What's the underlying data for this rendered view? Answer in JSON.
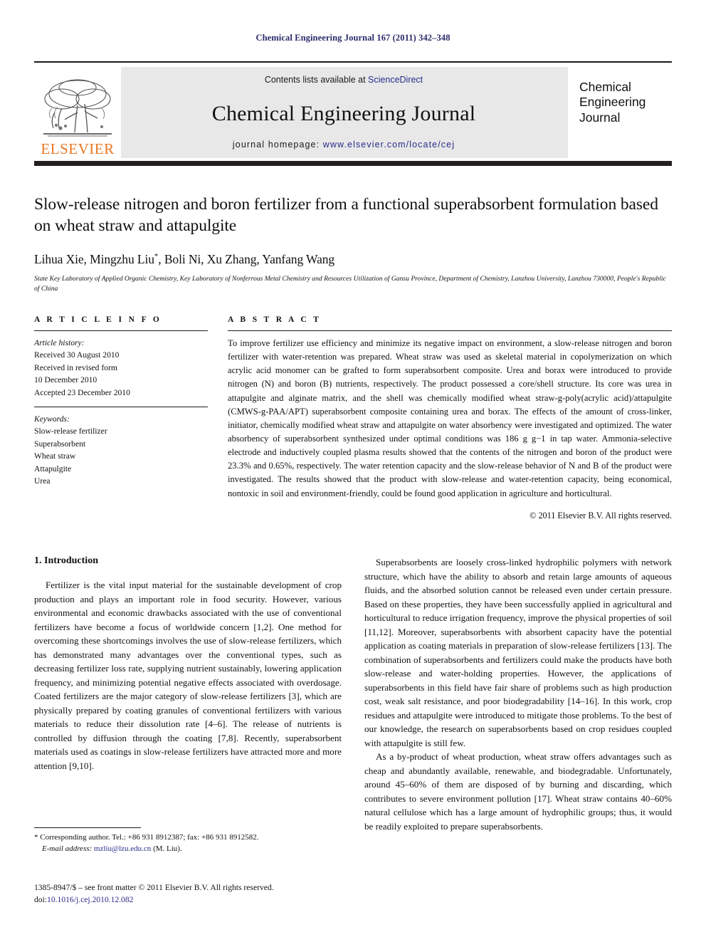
{
  "running_head": "Chemical Engineering Journal 167 (2011) 342–348",
  "masthead": {
    "contents_prefix": "Contents lists available at ",
    "sciencedirect": "ScienceDirect",
    "journal_title": "Chemical Engineering Journal",
    "homepage_prefix": "journal homepage: ",
    "homepage_url": "www.elsevier.com/locate/cej",
    "publisher": "ELSEVIER",
    "cover_title": "Chemical\nEngineering\nJournal",
    "cover_line1": "Chemical",
    "cover_line2": "Engineering",
    "cover_line3": "Journal",
    "accent_orange": "#E87722",
    "link_blue": "#2b2b8c",
    "panel_gray": "#e8e8e8"
  },
  "article": {
    "title": "Slow-release nitrogen and boron fertilizer from a functional superabsorbent formulation based on wheat straw and attapulgite",
    "authors": "Lihua Xie, Mingzhu Liu*, Boli Ni, Xu Zhang, Yanfang Wang",
    "affiliation": "State Key Laboratory of Applied Organic Chemistry, Key Laboratory of Nonferrous Metal Chemistry and Resources Utilization of Gansu Province, Department of Chemistry, Lanzhou University, Lanzhou 730000, People's Republic of China"
  },
  "article_info": {
    "heading": "A R T I C L E    I N F O",
    "history_label": "Article history:",
    "history": [
      "Received 30 August 2010",
      "Received in revised form",
      "10 December 2010",
      "Accepted 23 December 2010"
    ],
    "keywords_label": "Keywords:",
    "keywords": [
      "Slow-release fertilizer",
      "Superabsorbent",
      "Wheat straw",
      "Attapulgite",
      "Urea"
    ]
  },
  "abstract": {
    "heading": "A B S T R A C T",
    "text": "To improve fertilizer use efficiency and minimize its negative impact on environment, a slow-release nitrogen and boron fertilizer with water-retention was prepared. Wheat straw was used as skeletal material in copolymerization on which acrylic acid monomer can be grafted to form superabsorbent composite. Urea and borax were introduced to provide nitrogen (N) and boron (B) nutrients, respectively. The product possessed a core/shell structure. Its core was urea in attapulgite and alginate matrix, and the shell was chemically modified wheat straw-g-poly(acrylic acid)/attapulgite (CMWS-g-PAA/APT) superabsorbent composite containing urea and borax. The effects of the amount of cross-linker, initiator, chemically modified wheat straw and attapulgite on water absorbency were investigated and optimized. The water absorbency of superabsorbent synthesized under optimal conditions was 186 g g−1 in tap water. Ammonia-selective electrode and inductively coupled plasma results showed that the contents of the nitrogen and boron of the product were 23.3% and 0.65%, respectively. The water retention capacity and the slow-release behavior of N and B of the product were investigated. The results showed that the product with slow-release and water-retention capacity, being economical, nontoxic in soil and environment-friendly, could be found good application in agriculture and horticultural.",
    "copyright": "© 2011 Elsevier B.V. All rights reserved."
  },
  "body": {
    "section_heading": "1.  Introduction",
    "left_paragraphs": [
      "Fertilizer is the vital input material for the sustainable development of crop production and plays an important role in food security. However, various environmental and economic drawbacks associated with the use of conventional fertilizers have become a focus of worldwide concern [1,2]. One method for overcoming these shortcomings involves the use of slow-release fertilizers, which has demonstrated many advantages over the conventional types, such as decreasing fertilizer loss rate, supplying nutrient sustainably, lowering application frequency, and minimizing potential negative effects associated with overdosage. Coated fertilizers are the major category of slow-release fertilizers [3], which are physically prepared by coating granules of conventional fertilizers with various materials to reduce their dissolution rate [4–6]. The release of nutrients is controlled by diffusion through the coating [7,8]. Recently, superabsorbent materials used as coatings in slow-release fertilizers have attracted more and more attention [9,10]."
    ],
    "right_paragraphs": [
      "Superabsorbents are loosely cross-linked hydrophilic polymers with network structure, which have the ability to absorb and retain large amounts of aqueous fluids, and the absorbed solution cannot be released even under certain pressure. Based on these properties, they have been successfully applied in agricultural and horticultural to reduce irrigation frequency, improve the physical properties of soil [11,12]. Moreover, superabsorbents with absorbent capacity have the potential application as coating materials in preparation of slow-release fertilizers [13]. The combination of superabsorbents and fertilizers could make the products have both slow-release and water-holding properties. However, the applications of superabsorbents in this field have fair share of problems such as high production cost, weak salt resistance, and poor biodegradability [14–16]. In this work, crop residues and attapulgite were introduced to mitigate those problems. To the best of our knowledge, the research on superabsorbents based on crop residues coupled with attapulgite is still few.",
      "As a by-product of wheat production, wheat straw offers advantages such as cheap and abundantly available, renewable, and biodegradable. Unfortunately, around 45–60% of them are disposed of by burning and discarding, which contributes to severe environment pollution [17]. Wheat straw contains 40–60% natural cellulose which has a large amount of hydrophilic groups; thus, it would be readily exploited to prepare superabsorbents."
    ]
  },
  "footnote": {
    "corresponding": "* Corresponding author. Tel.: +86 931 8912387; fax: +86 931 8912582.",
    "email_label": "E-mail address:",
    "email": "mzliu@lzu.edu.cn",
    "email_suffix": "(M. Liu)."
  },
  "imprint": {
    "issn_line": "1385-8947/$ – see front matter © 2011 Elsevier B.V. All rights reserved.",
    "doi_label": "doi:",
    "doi": "10.1016/j.cej.2010.12.082"
  }
}
